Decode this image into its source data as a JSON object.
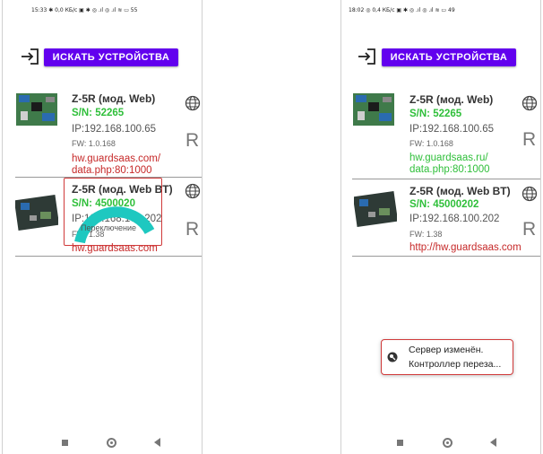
{
  "left_screen": {
    "status_bar": "15:33 ✱  0,0 КБ/с ▣ ✱ ◎ .ıl ◎ .ıl ≋ ▭ 55",
    "search_button": "ИСКАТЬ УСТРОЙСТВА",
    "devices": [
      {
        "name": "Z-5R (мод. Web)",
        "sn": "S/N: 52265",
        "ip": "IP:192.168.100.65",
        "fw": "FW: 1.0.168",
        "url_line1": "hw.guardsaas.com/",
        "url_line2": "data.php:80:1000",
        "r_label": "R"
      },
      {
        "name": "Z-5R (мод. Web BT)",
        "sn": "S/N: 4500020",
        "ip": "IP:192.168.100.202",
        "fw": "FW: 1.38",
        "url_line1": "hw.guardsaas.com",
        "r_label": "R"
      }
    ],
    "switching_label": "Переключение",
    "spinner_color": "#1ec8c0"
  },
  "right_screen": {
    "status_bar": "18:02 ◎  0,4 КБ/с ▣ ✱ ◎ .ıl ◎ .ıl ≋ ▭ 49",
    "search_button": "ИСКАТЬ УСТРОЙСТВА",
    "devices": [
      {
        "name": "Z-5R (мод. Web)",
        "sn": "S/N: 52265",
        "ip": "IP:192.168.100.65",
        "fw": "FW: 1.0.168",
        "url_line1": "hw.guardsaas.ru/",
        "url_line2": "data.php:80:1000",
        "r_label": "R"
      },
      {
        "name": "Z-5R (мод. Web BT)",
        "sn": "S/N: 45000202",
        "ip": "IP:192.168.100.202",
        "fw": "FW: 1.38",
        "url_line1": "http://hw.guardsaas.com",
        "r_label": "R"
      }
    ],
    "toast_line1": "Сервер изменён.",
    "toast_line2": "Контроллер переза..."
  },
  "colors": {
    "accent": "#6200ee",
    "sn_green": "#2fbf3a",
    "url_red": "#c62828",
    "highlight_red": "#d03a3a"
  }
}
